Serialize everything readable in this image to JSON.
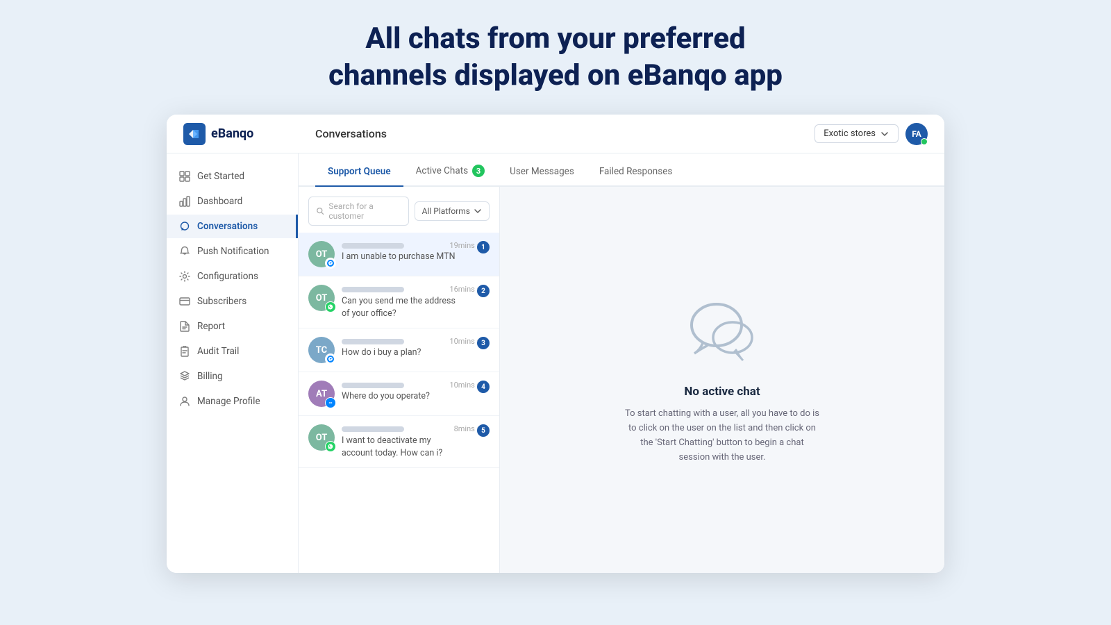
{
  "page": {
    "headline_line1": "All chats from your preferred",
    "headline_line2": "channels displayed on eBanqo app"
  },
  "topbar": {
    "logo_text": "eBanqo",
    "title": "Conversations",
    "store_label": "Exotic stores",
    "user_initials": "FA"
  },
  "sidebar": {
    "items": [
      {
        "id": "get-started",
        "label": "Get Started",
        "icon": "grid"
      },
      {
        "id": "dashboard",
        "label": "Dashboard",
        "icon": "bar-chart"
      },
      {
        "id": "conversations",
        "label": "Conversations",
        "icon": "message-circle",
        "active": true
      },
      {
        "id": "push-notification",
        "label": "Push Notification",
        "icon": "bell"
      },
      {
        "id": "configurations",
        "label": "Configurations",
        "icon": "settings"
      },
      {
        "id": "subscribers",
        "label": "Subscribers",
        "icon": "credit-card"
      },
      {
        "id": "report",
        "label": "Report",
        "icon": "file-text"
      },
      {
        "id": "audit-trail",
        "label": "Audit Trail",
        "icon": "clipboard"
      },
      {
        "id": "billing",
        "label": "Billing",
        "icon": "layers"
      },
      {
        "id": "manage-profile",
        "label": "Manage Profile",
        "icon": "user"
      }
    ]
  },
  "tabs": [
    {
      "id": "support-queue",
      "label": "Support Queue",
      "badge": null,
      "active": true
    },
    {
      "id": "active-chats",
      "label": "Active Chats",
      "badge": "3",
      "active": false
    },
    {
      "id": "user-messages",
      "label": "User Messages",
      "badge": null,
      "active": false
    },
    {
      "id": "failed-responses",
      "label": "Failed Responses",
      "badge": null,
      "active": false
    }
  ],
  "search": {
    "placeholder": "Search for a customer"
  },
  "filter": {
    "label": "All Platforms"
  },
  "chat_items": [
    {
      "id": "1",
      "initials": "OT",
      "avatar_class": "avatar-ot",
      "channel": "messenger",
      "message": "I am unable to purchase MTN",
      "time": "19mins ago",
      "num": "1",
      "selected": true
    },
    {
      "id": "2",
      "initials": "OT",
      "avatar_class": "avatar-ot",
      "channel": "whatsapp",
      "message_line1": "Can you send me the address",
      "message_line2": "of your office?",
      "time": "16mins ago",
      "num": "2",
      "selected": false
    },
    {
      "id": "3",
      "initials": "TC",
      "avatar_class": "avatar-tc",
      "channel": "messenger",
      "message": "How do i buy a plan?",
      "time": "10mins ago",
      "num": "3",
      "selected": false
    },
    {
      "id": "4",
      "initials": "AT",
      "avatar_class": "avatar-at",
      "channel": "livechat",
      "message": "Where do you operate?",
      "time": "10mins ago",
      "num": "4",
      "selected": false
    },
    {
      "id": "5",
      "initials": "OT",
      "avatar_class": "avatar-ot",
      "channel": "whatsapp",
      "message_line1": "I want to deactivate my",
      "message_line2": "account today. How can i?",
      "time": "8mins ago",
      "num": "5",
      "selected": false
    }
  ],
  "no_active_chat": {
    "title": "No active chat",
    "description": "To start chatting with a user, all you have to do is to click on the user on the list and then click on the 'Start Chatting' button to begin a chat session with the user."
  }
}
